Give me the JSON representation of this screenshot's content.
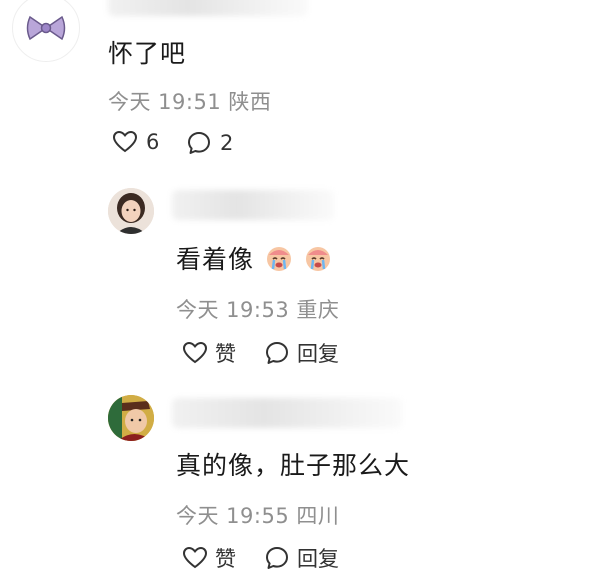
{
  "main_comment": {
    "text": "怀了吧",
    "time": "今天 19:51",
    "location": "陕西",
    "like_count": "6",
    "reply_count": "2",
    "avatar_icon": "bow-icon"
  },
  "replies": [
    {
      "text": "看着像",
      "emoji": [
        "crying-emoji",
        "crying-emoji"
      ],
      "time": "今天 19:53",
      "location": "重庆",
      "like_label": "赞",
      "reply_label": "回复"
    },
    {
      "text": "真的像，肚子那么大",
      "time": "今天 19:55",
      "location": "四川",
      "like_label": "赞",
      "reply_label": "回复"
    }
  ],
  "colors": {
    "meta_text": "#8f8f8f",
    "body_text": "#1a1a1a",
    "icon_stroke": "#333333",
    "bow": "#b9a6d9"
  }
}
